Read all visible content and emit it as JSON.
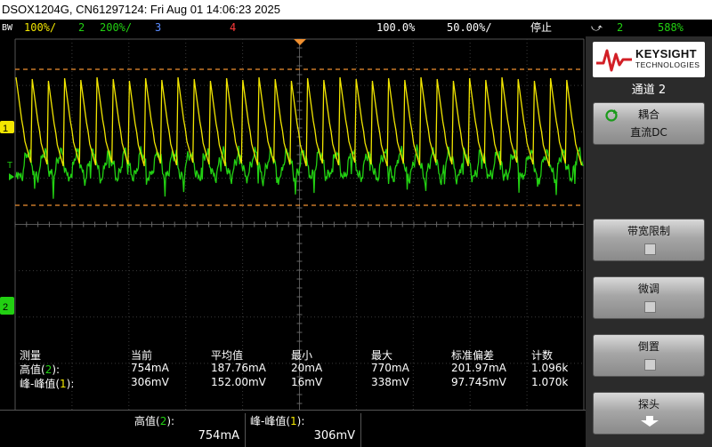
{
  "title_bar": {
    "text": "DSOX1204G, CN61297124: Fri Aug 01 14:06:23 2025"
  },
  "top_bar": {
    "bw": "BW",
    "ch1_scale": "100%/",
    "ch2_num": "2",
    "ch2_scale": "200%/",
    "ch3_num": "3",
    "ch4_num": "4",
    "time_scale": "100.0%",
    "delay": "50.00%/",
    "run_state": "停止",
    "trigger_ch": "2",
    "trigger_level": "588%"
  },
  "sidebar": {
    "logo_brand": "KEYSIGHT",
    "logo_sub": "TECHNOLOGIES",
    "menu_title": "通道 2",
    "coupling": {
      "label": "耦合",
      "value": "直流DC"
    },
    "bw_limit": {
      "label": "带宽限制"
    },
    "fine": {
      "label": "微调"
    },
    "invert": {
      "label": "倒置"
    },
    "probe": {
      "label": "探头"
    }
  },
  "measurements": {
    "headers": [
      "测量",
      "当前",
      "平均值",
      "最小",
      "最大",
      "标准偏差",
      "计数"
    ],
    "rows": [
      {
        "name_prefix": "高值(",
        "ch": "2",
        "name_suffix": "):",
        "current": "754mA",
        "mean": "187.76mA",
        "min": "20mA",
        "max": "770mA",
        "std": "201.97mA",
        "count": "1.096k"
      },
      {
        "name_prefix": "峰-峰值(",
        "ch": "1",
        "name_suffix": "):",
        "current": "306mV",
        "mean": "152.00mV",
        "min": "16mV",
        "max": "338mV",
        "std": "97.745mV",
        "count": "1.070k"
      }
    ]
  },
  "footer": [
    {
      "label_prefix": "高值(",
      "ch": "2",
      "label_suffix": "):",
      "value": "754mA"
    },
    {
      "label_prefix": "峰-峰值(",
      "ch": "1",
      "label_suffix": "):",
      "value": "306mV"
    }
  ],
  "markers": {
    "ch1": "1",
    "ch2": "2",
    "trigger": "T"
  },
  "colors": {
    "ch1": "#f2e600",
    "ch2": "#22d012",
    "ch3": "#5a8cff",
    "ch4": "#ff3a3a",
    "cursor": "#f09030",
    "grid": "#555555"
  },
  "waveforms": {
    "ch1": "sawtooth",
    "ch2": "oscillating"
  }
}
